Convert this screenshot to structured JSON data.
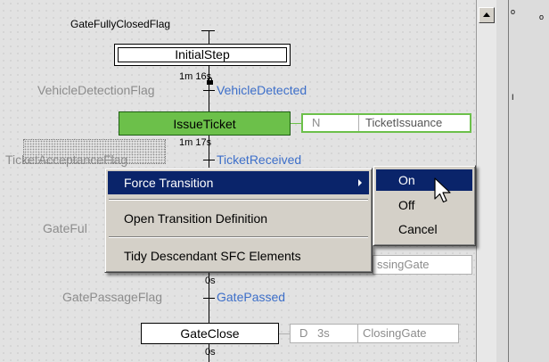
{
  "sfc": {
    "top_flag": "GateFullyClosedFlag",
    "steps": [
      {
        "name": "InitialStep"
      },
      {
        "name": "IssueTicket"
      },
      {
        "name": "GateClose"
      }
    ],
    "timers": [
      "1m 16s",
      "1m 17s",
      "0s",
      "0s"
    ],
    "transitions": [
      {
        "flag": "VehicleDetectionFlag",
        "name": "VehicleDetected"
      },
      {
        "flag": "TicketAcceptanceFlag",
        "name": "TicketReceived"
      },
      {
        "flag": "GatePassageFlag",
        "name": "GatePassed"
      }
    ],
    "partial_flag": "GateFul",
    "actions": [
      {
        "qualifier": "N",
        "time": "",
        "name": "TicketIssuance"
      },
      {
        "qualifier": "",
        "time": "",
        "name": "ssingGate"
      },
      {
        "qualifier": "D",
        "time": "3s",
        "name": "ClosingGate"
      }
    ]
  },
  "context_menu": {
    "items": [
      "Force Transition",
      "Open Transition Definition",
      "Tidy Descendant SFC Elements"
    ]
  },
  "submenu": {
    "items": [
      "On",
      "Off",
      "Cancel"
    ],
    "highlighted": "On"
  },
  "right_panel": {
    "labels": [
      "o",
      "o",
      "I"
    ]
  },
  "colors": {
    "active_step": "#6cc04a",
    "transition_text": "#3d6fc9",
    "menu_highlight": "#0a246a",
    "menu_background": "#d4d0c8"
  }
}
